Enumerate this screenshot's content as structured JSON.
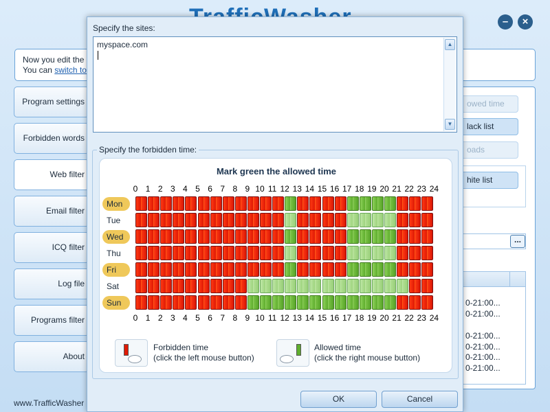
{
  "app": {
    "title": "TrafficWasher",
    "info_line1": "Now you edit the",
    "info_line2_prefix": "You can ",
    "info_link": "switch to",
    "footer_url": "www.TrafficWasher"
  },
  "nav": {
    "items": [
      {
        "label": "Program settings"
      },
      {
        "label": "Forbidden words"
      },
      {
        "label": "Web filter"
      },
      {
        "label": "Email filter"
      },
      {
        "label": "ICQ filter"
      },
      {
        "label": "Log file"
      },
      {
        "label": "Programs filter"
      },
      {
        "label": "About"
      }
    ],
    "active_index": 2
  },
  "right_panel": {
    "allowed_time_btn": "owed time",
    "black_list_btn": "lack list",
    "downloads_btn": "oads",
    "white_list_btn": "hite list",
    "browse_btn": "...",
    "rows": [
      "0-21:00...",
      "0-21:00...",
      "0-21:00...",
      "0-21:00...",
      "0-21:00...",
      "0-21:00..."
    ]
  },
  "dialog": {
    "sites_label": "Specify the sites:",
    "sites_value": "myspace.com",
    "time_label": "Specify the forbidden time:",
    "grid_title": "Mark green the allowed time",
    "hours": [
      "0",
      "1",
      "2",
      "3",
      "4",
      "5",
      "6",
      "7",
      "8",
      "9",
      "10",
      "11",
      "12",
      "13",
      "14",
      "15",
      "16",
      "17",
      "18",
      "19",
      "20",
      "21",
      "22",
      "23",
      "24"
    ],
    "days": [
      {
        "label": "Mon",
        "highlight": true,
        "allowed": [
          12,
          17,
          18,
          19,
          20
        ]
      },
      {
        "label": "Tue",
        "highlight": false,
        "allowed": [
          12,
          17,
          18,
          19,
          20
        ]
      },
      {
        "label": "Wed",
        "highlight": true,
        "allowed": [
          12,
          17,
          18,
          19,
          20
        ]
      },
      {
        "label": "Thu",
        "highlight": false,
        "allowed": [
          12,
          17,
          18,
          19,
          20
        ]
      },
      {
        "label": "Fri",
        "highlight": true,
        "allowed": [
          12,
          17,
          18,
          19,
          20
        ]
      },
      {
        "label": "Sat",
        "highlight": false,
        "allowed": [
          9,
          10,
          11,
          12,
          13,
          14,
          15,
          16,
          17,
          18,
          19,
          20,
          21
        ]
      },
      {
        "label": "Sun",
        "highlight": true,
        "allowed": [
          9,
          10,
          11,
          12,
          13,
          14,
          15,
          16,
          17,
          18,
          19,
          20
        ]
      }
    ],
    "legend": {
      "forbidden_title": "Forbidden time",
      "forbidden_hint": "(click the left mouse button)",
      "allowed_title": "Allowed time",
      "allowed_hint": "(click the right mouse button)"
    },
    "ok_label": "OK",
    "cancel_label": "Cancel"
  },
  "colors": {
    "forbidden": "#e01a05",
    "allowed": "#5fae2e",
    "day_highlight": "#efc85a",
    "accent": "#1f6fb8"
  }
}
